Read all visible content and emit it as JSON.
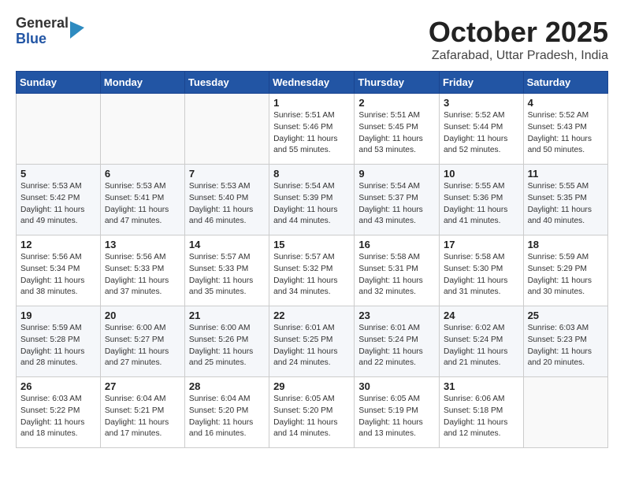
{
  "header": {
    "logo": {
      "general": "General",
      "blue": "Blue"
    },
    "title": "October 2025",
    "location": "Zafarabad, Uttar Pradesh, India"
  },
  "calendar": {
    "weekdays": [
      "Sunday",
      "Monday",
      "Tuesday",
      "Wednesday",
      "Thursday",
      "Friday",
      "Saturday"
    ],
    "weeks": [
      [
        {
          "day": "",
          "detail": ""
        },
        {
          "day": "",
          "detail": ""
        },
        {
          "day": "",
          "detail": ""
        },
        {
          "day": "1",
          "detail": "Sunrise: 5:51 AM\nSunset: 5:46 PM\nDaylight: 11 hours\nand 55 minutes."
        },
        {
          "day": "2",
          "detail": "Sunrise: 5:51 AM\nSunset: 5:45 PM\nDaylight: 11 hours\nand 53 minutes."
        },
        {
          "day": "3",
          "detail": "Sunrise: 5:52 AM\nSunset: 5:44 PM\nDaylight: 11 hours\nand 52 minutes."
        },
        {
          "day": "4",
          "detail": "Sunrise: 5:52 AM\nSunset: 5:43 PM\nDaylight: 11 hours\nand 50 minutes."
        }
      ],
      [
        {
          "day": "5",
          "detail": "Sunrise: 5:53 AM\nSunset: 5:42 PM\nDaylight: 11 hours\nand 49 minutes."
        },
        {
          "day": "6",
          "detail": "Sunrise: 5:53 AM\nSunset: 5:41 PM\nDaylight: 11 hours\nand 47 minutes."
        },
        {
          "day": "7",
          "detail": "Sunrise: 5:53 AM\nSunset: 5:40 PM\nDaylight: 11 hours\nand 46 minutes."
        },
        {
          "day": "8",
          "detail": "Sunrise: 5:54 AM\nSunset: 5:39 PM\nDaylight: 11 hours\nand 44 minutes."
        },
        {
          "day": "9",
          "detail": "Sunrise: 5:54 AM\nSunset: 5:37 PM\nDaylight: 11 hours\nand 43 minutes."
        },
        {
          "day": "10",
          "detail": "Sunrise: 5:55 AM\nSunset: 5:36 PM\nDaylight: 11 hours\nand 41 minutes."
        },
        {
          "day": "11",
          "detail": "Sunrise: 5:55 AM\nSunset: 5:35 PM\nDaylight: 11 hours\nand 40 minutes."
        }
      ],
      [
        {
          "day": "12",
          "detail": "Sunrise: 5:56 AM\nSunset: 5:34 PM\nDaylight: 11 hours\nand 38 minutes."
        },
        {
          "day": "13",
          "detail": "Sunrise: 5:56 AM\nSunset: 5:33 PM\nDaylight: 11 hours\nand 37 minutes."
        },
        {
          "day": "14",
          "detail": "Sunrise: 5:57 AM\nSunset: 5:33 PM\nDaylight: 11 hours\nand 35 minutes."
        },
        {
          "day": "15",
          "detail": "Sunrise: 5:57 AM\nSunset: 5:32 PM\nDaylight: 11 hours\nand 34 minutes."
        },
        {
          "day": "16",
          "detail": "Sunrise: 5:58 AM\nSunset: 5:31 PM\nDaylight: 11 hours\nand 32 minutes."
        },
        {
          "day": "17",
          "detail": "Sunrise: 5:58 AM\nSunset: 5:30 PM\nDaylight: 11 hours\nand 31 minutes."
        },
        {
          "day": "18",
          "detail": "Sunrise: 5:59 AM\nSunset: 5:29 PM\nDaylight: 11 hours\nand 30 minutes."
        }
      ],
      [
        {
          "day": "19",
          "detail": "Sunrise: 5:59 AM\nSunset: 5:28 PM\nDaylight: 11 hours\nand 28 minutes."
        },
        {
          "day": "20",
          "detail": "Sunrise: 6:00 AM\nSunset: 5:27 PM\nDaylight: 11 hours\nand 27 minutes."
        },
        {
          "day": "21",
          "detail": "Sunrise: 6:00 AM\nSunset: 5:26 PM\nDaylight: 11 hours\nand 25 minutes."
        },
        {
          "day": "22",
          "detail": "Sunrise: 6:01 AM\nSunset: 5:25 PM\nDaylight: 11 hours\nand 24 minutes."
        },
        {
          "day": "23",
          "detail": "Sunrise: 6:01 AM\nSunset: 5:24 PM\nDaylight: 11 hours\nand 22 minutes."
        },
        {
          "day": "24",
          "detail": "Sunrise: 6:02 AM\nSunset: 5:24 PM\nDaylight: 11 hours\nand 21 minutes."
        },
        {
          "day": "25",
          "detail": "Sunrise: 6:03 AM\nSunset: 5:23 PM\nDaylight: 11 hours\nand 20 minutes."
        }
      ],
      [
        {
          "day": "26",
          "detail": "Sunrise: 6:03 AM\nSunset: 5:22 PM\nDaylight: 11 hours\nand 18 minutes."
        },
        {
          "day": "27",
          "detail": "Sunrise: 6:04 AM\nSunset: 5:21 PM\nDaylight: 11 hours\nand 17 minutes."
        },
        {
          "day": "28",
          "detail": "Sunrise: 6:04 AM\nSunset: 5:20 PM\nDaylight: 11 hours\nand 16 minutes."
        },
        {
          "day": "29",
          "detail": "Sunrise: 6:05 AM\nSunset: 5:20 PM\nDaylight: 11 hours\nand 14 minutes."
        },
        {
          "day": "30",
          "detail": "Sunrise: 6:05 AM\nSunset: 5:19 PM\nDaylight: 11 hours\nand 13 minutes."
        },
        {
          "day": "31",
          "detail": "Sunrise: 6:06 AM\nSunset: 5:18 PM\nDaylight: 11 hours\nand 12 minutes."
        },
        {
          "day": "",
          "detail": ""
        }
      ]
    ]
  }
}
